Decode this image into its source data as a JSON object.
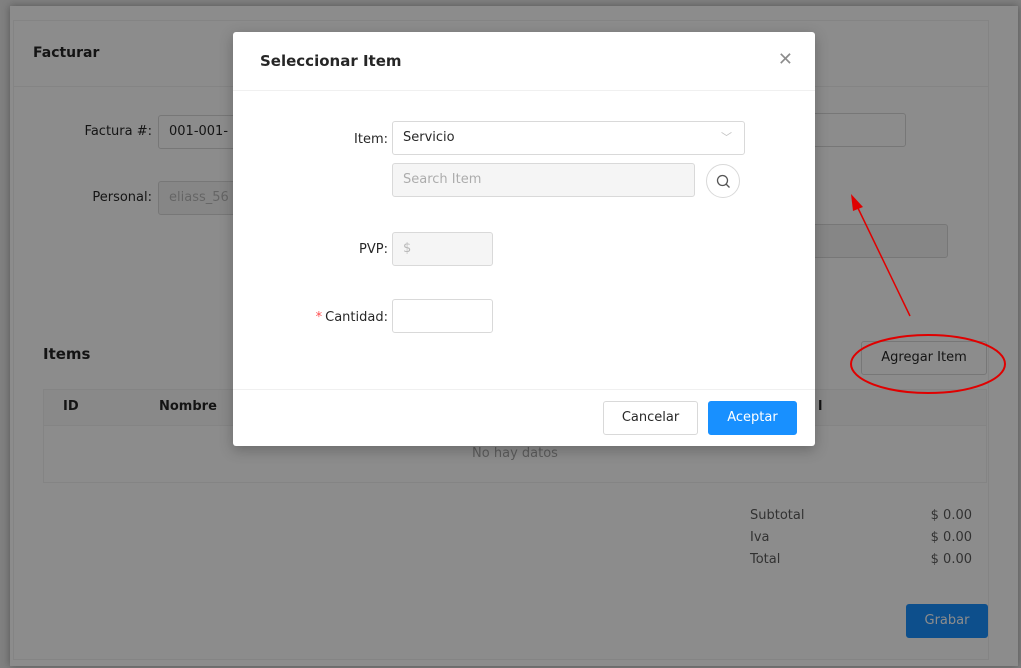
{
  "page": {
    "card_title": "Facturar",
    "factura_label": "Factura #:",
    "factura_value": "001-001-",
    "personal_label": "Personal:",
    "personal_value": "eliass_56",
    "items_title": "Items",
    "add_item_button": "Agregar Item",
    "table": {
      "columns": [
        "ID",
        "Nombre",
        "l"
      ],
      "empty_text": "No hay datos"
    },
    "totals": [
      {
        "label": "Subtotal",
        "value": "$ 0.00"
      },
      {
        "label": "Iva",
        "value": "$ 0.00"
      },
      {
        "label": "Total",
        "value": "$ 0.00"
      }
    ],
    "save_button": "Grabar"
  },
  "modal": {
    "title": "Seleccionar Item",
    "close_icon": "close-icon",
    "item_label": "Item",
    "item_select_value": "Servicio",
    "search_placeholder": "Search Item",
    "search_icon": "search-icon",
    "pvp_label": "PVP",
    "pvp_placeholder": "$",
    "cantidad_required_mark": "*",
    "cantidad_label": "Cantidad",
    "cancel_button": "Cancelar",
    "accept_button": "Aceptar"
  },
  "colors": {
    "primary": "#1890ff",
    "annotation": "#e00000",
    "required": "#ff4d4f"
  }
}
